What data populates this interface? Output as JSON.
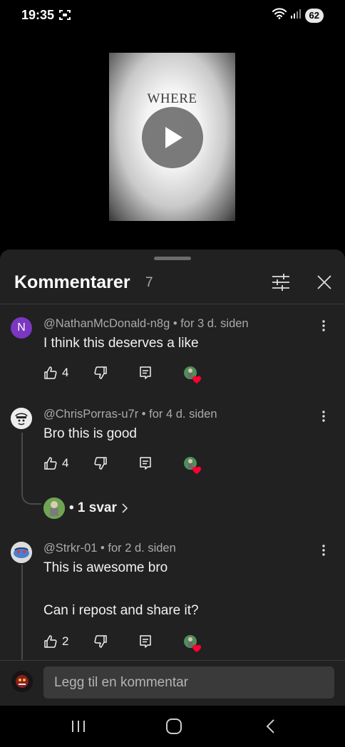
{
  "status_bar": {
    "time": "19:35",
    "battery": "62"
  },
  "video": {
    "thumbnail_title": "WHERE"
  },
  "comments_sheet": {
    "title": "Kommentarer",
    "count": "7",
    "comments": [
      {
        "avatar_letter": "N",
        "author": "@NathanMcDonald-n8g",
        "time": " • for 3 d. siden",
        "text": "I think this deserves a like",
        "likes": "4"
      },
      {
        "author": "@ChrisPorras-u7r",
        "time": " • for 4 d. siden",
        "text": "Bro this is good",
        "likes": "4",
        "replies_label": "• 1 svar"
      },
      {
        "author": "@Strkr-01",
        "time": " • for 2 d. siden",
        "text_line1": "This is awesome bro",
        "text_line2": "Can i repost and share it?",
        "likes": "2"
      }
    ]
  },
  "composer": {
    "placeholder": "Legg til en kommentar"
  },
  "colors": {
    "sheet_bg": "#212121",
    "heart": "#ff0033",
    "avatar_n": "#7b36c2"
  }
}
